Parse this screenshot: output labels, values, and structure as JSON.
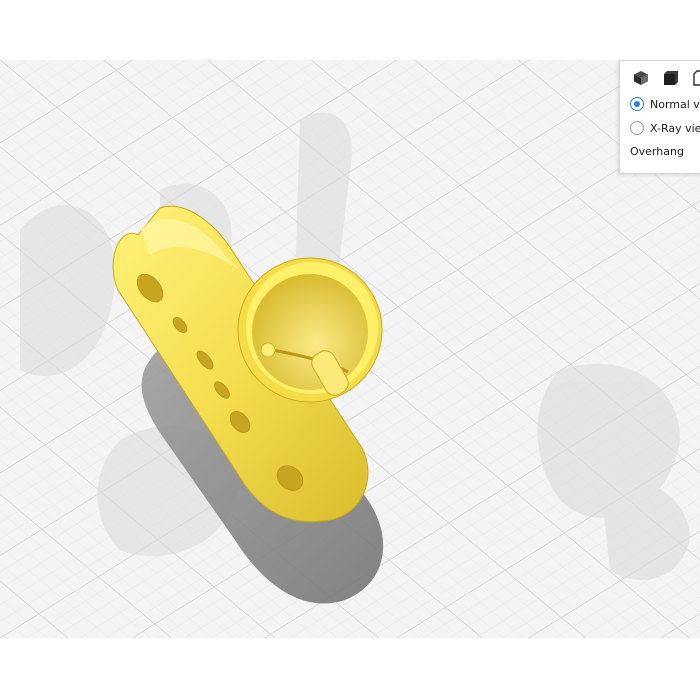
{
  "view_panel": {
    "icons": [
      "3d-view-icon",
      "front-view-icon",
      "side-view-icon"
    ],
    "options": [
      {
        "label": "Normal vi",
        "checked": true
      },
      {
        "label": "X-Ray view",
        "checked": false
      }
    ],
    "overhang_label": "Overhang"
  },
  "colors": {
    "model_yellow": "#f7e35b",
    "radio_accent": "#2a7de1",
    "grid_line": "#cfcfcf",
    "build_plate": "#f4f4f4"
  }
}
